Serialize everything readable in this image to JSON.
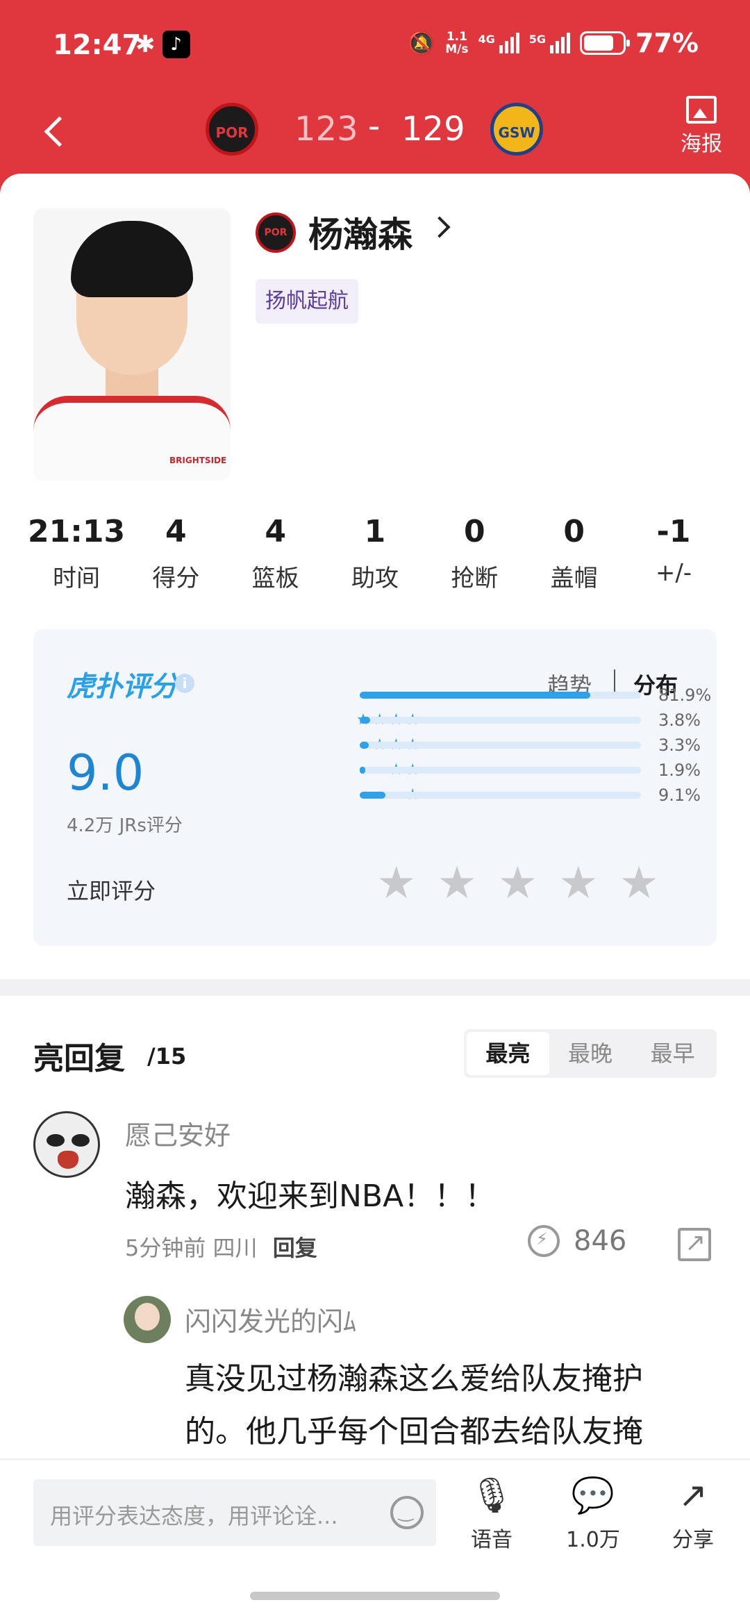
{
  "status_bar": {
    "time": "12:47",
    "net_speed_top": "1.1",
    "net_speed_unit": "M/s",
    "signal1_label": "4G",
    "signal2_label": "5G",
    "battery_level": 0.77,
    "battery_text": "77%"
  },
  "header": {
    "home_team": "POR",
    "away_team": "GSW",
    "home_score": "123",
    "separator": "-",
    "away_score": "129",
    "poster_label": "海报"
  },
  "player": {
    "team_abbr": "POR",
    "name": "杨瀚森",
    "tag": "扬帆起航",
    "jersey_text": "BRIGHTSIDE"
  },
  "stats": [
    {
      "value": "21:13",
      "label": "时间"
    },
    {
      "value": "4",
      "label": "得分"
    },
    {
      "value": "4",
      "label": "篮板"
    },
    {
      "value": "1",
      "label": "助攻"
    },
    {
      "value": "0",
      "label": "抢断"
    },
    {
      "value": "0",
      "label": "盖帽"
    },
    {
      "value": "-1",
      "label": "+/-"
    }
  ],
  "rating": {
    "logo_text": "虎扑评分",
    "registered": "®",
    "tab_trend": "趋势",
    "tab_distribution": "分布",
    "score": "9.0",
    "count": "4.2万 JRs评分",
    "rate_now": "立即评分",
    "distribution": [
      {
        "stars": "★★★★★",
        "percent": "81.9%",
        "value": 81.9
      },
      {
        "stars": "★★★★",
        "percent": "3.8%",
        "value": 3.8
      },
      {
        "stars": "★★★",
        "percent": "3.3%",
        "value": 3.3
      },
      {
        "stars": "★★",
        "percent": "1.9%",
        "value": 1.9
      },
      {
        "stars": "★",
        "percent": "9.1%",
        "value": 9.1
      }
    ]
  },
  "replies": {
    "title": "亮回复",
    "count": "/15",
    "sort_tabs": [
      "最亮",
      "最晚",
      "最早"
    ],
    "comment1": {
      "user": "愿己安好",
      "text": "瀚森，欢迎来到NBA！！！",
      "time": "5分钟前",
      "location": "四川",
      "reply_label": "回复",
      "likes": "846"
    },
    "comment2": {
      "user": "闪闪发光的闪ﾑ",
      "text": "真没见过杨瀚森这么爱给队友掩护的。他几乎每个回合都去给队友掩"
    }
  },
  "bottom_bar": {
    "input_placeholder": "用评分表达态度，用评论诠...",
    "voice_label": "语音",
    "comments_label": "1.0万",
    "share_label": "分享"
  }
}
